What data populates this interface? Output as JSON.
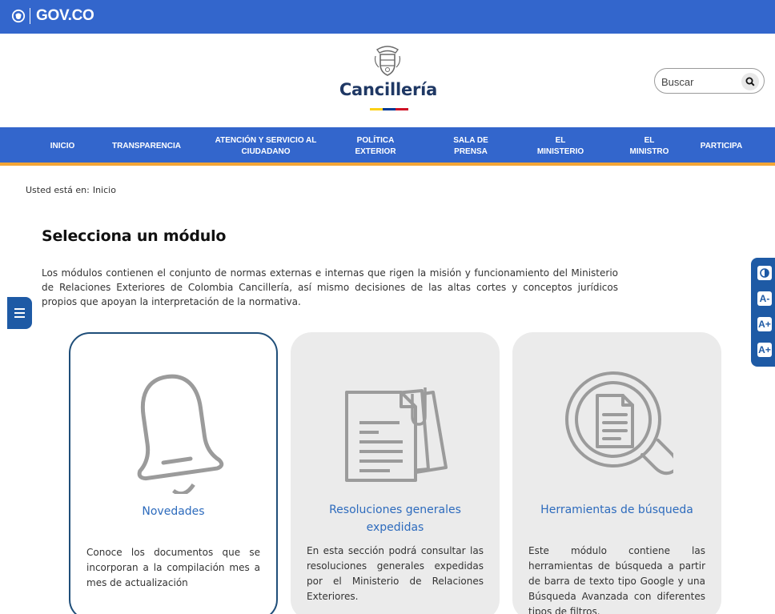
{
  "gov_bar": {
    "logo_text": "GOV.CO",
    "color": "#3366cc"
  },
  "header": {
    "brand_name": "Cancillería",
    "search": {
      "placeholder": "Buscar"
    }
  },
  "nav": {
    "items": [
      {
        "label": "INICIO"
      },
      {
        "label": "TRANSPARENCIA"
      },
      {
        "label": "ATENCIÓN Y SERVICIO AL CIUDADANO"
      },
      {
        "label": "POLÍTICA EXTERIOR"
      },
      {
        "label": "SALA DE PRENSA"
      },
      {
        "label": "EL MINISTERIO"
      },
      {
        "label": "EL MINISTRO"
      },
      {
        "label": "PARTICIPA"
      }
    ],
    "accent_color": "#f3a536"
  },
  "breadcrumb": {
    "prefix": "Usted está en:",
    "current": "Inicio"
  },
  "main": {
    "title": "Selecciona un módulo",
    "intro": "Los módulos contienen el conjunto de normas externas e internas que rigen la misión y funcionamiento del Ministerio de Relaciones Exteriores de Colombia Cancillería, así mismo decisiones de las altas cortes y conceptos jurídicos propios que apoyan la interpretación de la normativa."
  },
  "modules": [
    {
      "icon": "bell-icon",
      "title": "Novedades",
      "description": "Conoce los documentos que se incorporan a la compilación mes a mes de actualización"
    },
    {
      "icon": "documents-icon",
      "title": "Resoluciones generales expedidas",
      "description": "En esta sección podrá consultar las resoluciones generales expedidas por el Ministerio de Relaciones Exteriores."
    },
    {
      "icon": "magnifier-document-icon",
      "title": "Herramientas de búsqueda",
      "description": "Este módulo contiene las herramientas de búsqueda a partir de barra de texto tipo Google y una Búsqueda Avanzada con diferentes tipos de filtros."
    }
  ],
  "accessibility": {
    "contrast_label": "contrast-icon",
    "decrease_label": "A-",
    "increase_label": "A+",
    "increase_more_label": "A+"
  },
  "colors": {
    "primary": "#3366cc",
    "brand_text": "#1f3864",
    "link": "#2d6bbd",
    "flag_yellow": "#fcd116",
    "flag_blue": "#003893",
    "flag_red": "#ce1126"
  }
}
